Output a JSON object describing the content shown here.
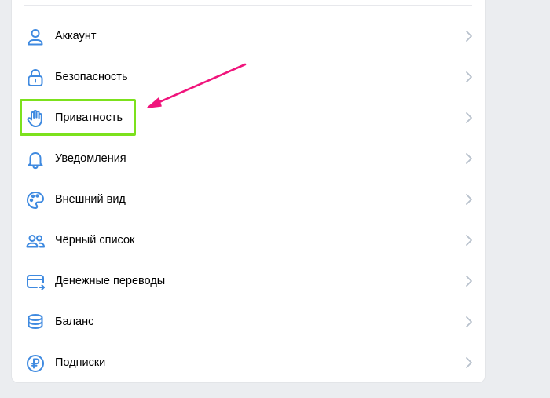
{
  "menu": {
    "items": [
      {
        "label": "Аккаунт",
        "icon": "user-icon"
      },
      {
        "label": "Безопасность",
        "icon": "lock-icon"
      },
      {
        "label": "Приватность",
        "icon": "hand-icon"
      },
      {
        "label": "Уведомления",
        "icon": "bell-icon"
      },
      {
        "label": "Внешний вид",
        "icon": "palette-icon"
      },
      {
        "label": "Чёрный список",
        "icon": "users-icon"
      },
      {
        "label": "Денежные переводы",
        "icon": "card-transfer-icon"
      },
      {
        "label": "Баланс",
        "icon": "coins-icon"
      },
      {
        "label": "Подписки",
        "icon": "ruble-icon"
      }
    ]
  },
  "colors": {
    "icon": "#3f8ae0",
    "chevron": "#b8c1cc",
    "highlight": "#7ce11d",
    "arrow": "#f0147c",
    "background": "#ebedf0",
    "card": "#ffffff"
  }
}
